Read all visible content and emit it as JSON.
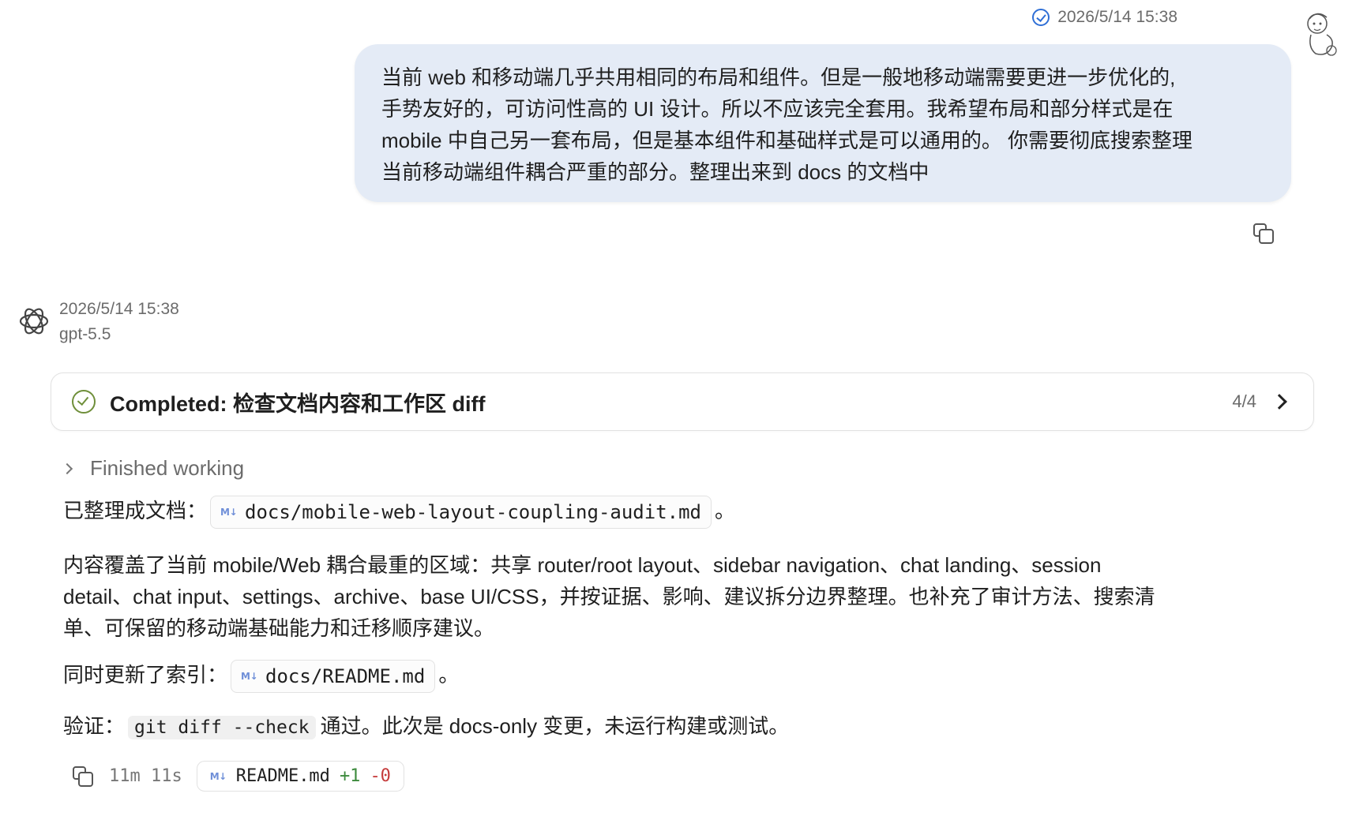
{
  "user_message": {
    "timestamp": "2026/5/14 15:38",
    "text_lines": [
      "当前 web 和移动端几乎共用相同的布局和组件。但是一般地移动端需要更进一步优化的,",
      "手势友好的，可访问性高的  UI 设计。所以不应该完全套用。我希望布局和部分样式是在",
      "mobile 中自己另一套布局，但是基本组件和基础样式是可以通用的。 你需要彻底搜索整理",
      "当前移动端组件耦合严重的部分。整理出来到 docs 的文档中"
    ]
  },
  "assistant": {
    "timestamp": "2026/5/14 15:38",
    "model": "gpt-5.5",
    "todo": {
      "title": "Completed: 检查文档内容和工作区 diff",
      "count": "4/4"
    },
    "finished_label": "Finished working",
    "para1": {
      "prefix": "已整理成文档：",
      "file": "docs/mobile-web-layout-coupling-audit.md",
      "suffix": "。"
    },
    "para2_lines": [
      "内容覆盖了当前 mobile/Web 耦合最重的区域：共享 router/root layout、sidebar navigation、chat landing、session",
      "detail、chat input、settings、archive、base UI/CSS，并按证据、影响、建议拆分边界整理。也补充了审计方法、搜索清",
      "单、可保留的移动端基础能力和迁移顺序建议。"
    ],
    "para3": {
      "prefix": "同时更新了索引：",
      "file": "docs/README.md",
      "suffix": "。"
    },
    "para4": {
      "prefix": "验证：",
      "code": "git diff --check",
      "suffix": "通过。此次是 docs-only 变更，未运行构建或测试。"
    },
    "footer": {
      "duration": "11m 11s",
      "file": "README.md",
      "additions": "+1",
      "deletions": "-0"
    },
    "md_badge": "M↓"
  }
}
